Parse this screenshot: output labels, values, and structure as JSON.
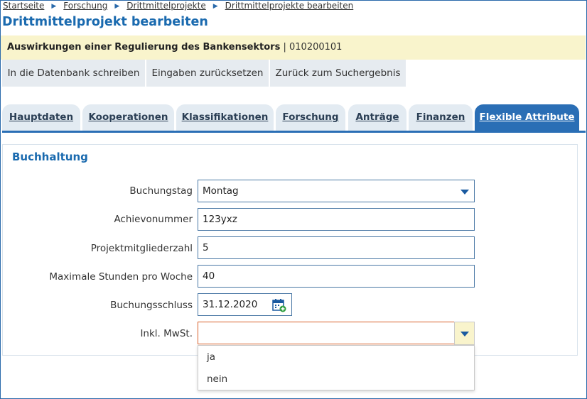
{
  "breadcrumb": [
    "Startseite",
    "Forschung",
    "Drittmittelprojekte",
    "Drittmittelprojekte bearbeiten"
  ],
  "page_title": "Drittmittelprojekt bearbeiten",
  "project": {
    "title": "Auswirkungen einer Regulierung des Bankensektors",
    "separator": "|",
    "number": "010200101"
  },
  "buttons": {
    "save": "In die Datenbank schreiben",
    "reset": "Eingaben zurücksetzen",
    "back": "Zurück zum Suchergebnis"
  },
  "tabs": [
    {
      "label": "Hauptdaten"
    },
    {
      "label": "Kooperationen"
    },
    {
      "label": "Klassifikationen"
    },
    {
      "label": "Forschung"
    },
    {
      "label": "Anträge"
    },
    {
      "label": "Finanzen"
    },
    {
      "label": "Flexible Attribute",
      "active": true
    }
  ],
  "section_title": "Buchhaltung",
  "form": {
    "buchungstag": {
      "label": "Buchungstag",
      "value": "Montag"
    },
    "achievonummer": {
      "label": "Achievonummer",
      "value": "123yxz"
    },
    "projektmitglieder": {
      "label": "Projektmitgliederzahl",
      "value": "5"
    },
    "max_stunden": {
      "label": "Maximale Stunden pro Woche",
      "value": "40"
    },
    "buchungsschluss": {
      "label": "Buchungsschluss",
      "value": "31.12.2020"
    },
    "mwst": {
      "label": "Inkl. MwSt.",
      "value": "",
      "options": [
        "ja",
        "nein"
      ]
    }
  },
  "colors": {
    "accent": "#1a6aaf",
    "active_tab": "#2a6eb5",
    "highlight": "#f9f4cc",
    "error_border": "#d9602a"
  }
}
